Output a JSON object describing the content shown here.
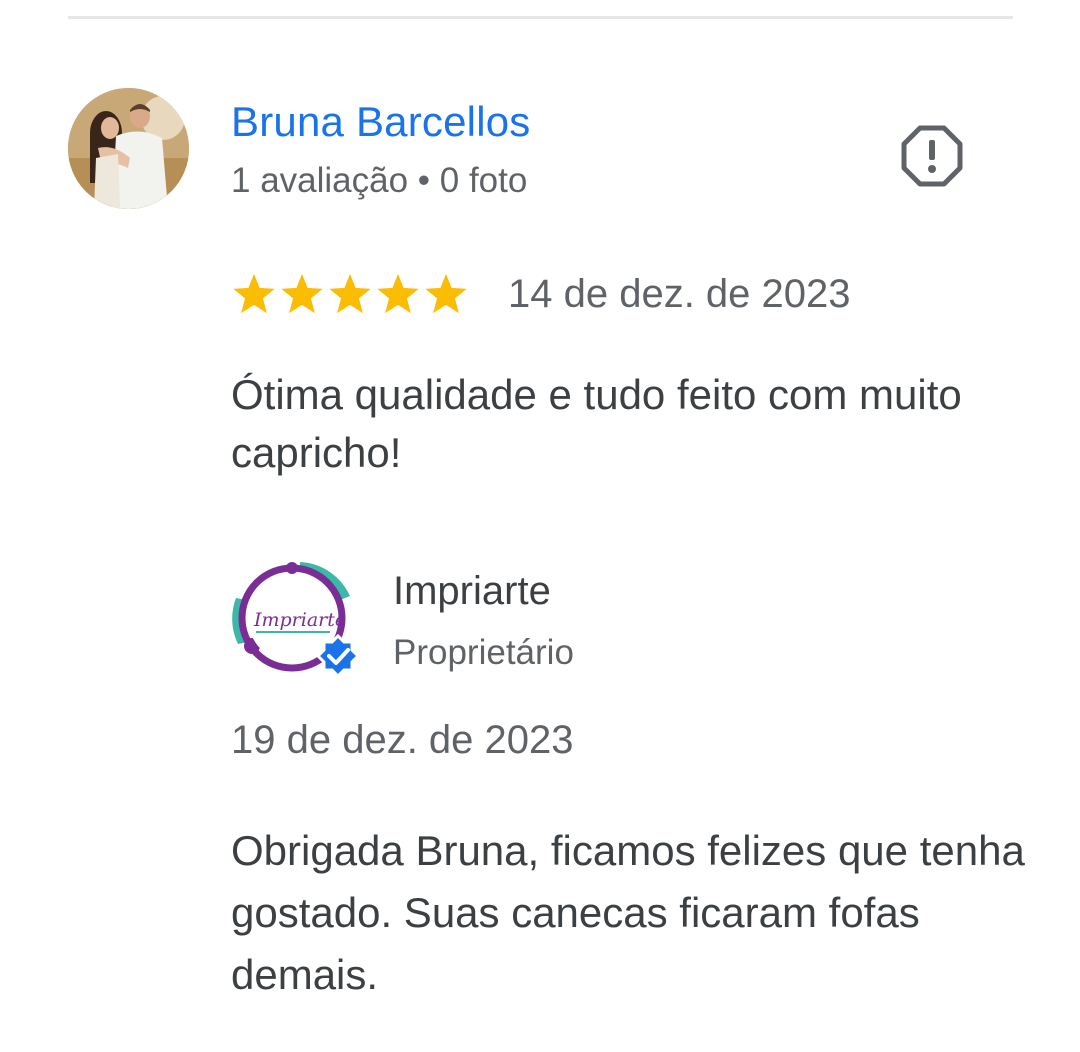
{
  "review": {
    "reviewer_name": "Bruna Barcellos",
    "reviewer_meta": "1 avaliação • 0 foto",
    "rating": 5,
    "max_rating": 5,
    "date": "14 de dez. de 2023",
    "text": "Ótima qualidade e tudo feito com muito capricho!",
    "avatar_icon": "reviewer-avatar-photo",
    "report_icon": "report-icon"
  },
  "owner_reply": {
    "name": "Impriarte",
    "role": "Proprietário",
    "date": "19 de dez. de 2023",
    "text": "Obrigada Bruna, ficamos felizes que tenha gostado. Suas canecas ficaram fofas demais.",
    "logo_text": "Impriarte",
    "verified_icon": "verified-badge-icon"
  },
  "colors": {
    "link_blue": "#1a73e8",
    "star_yellow": "#fbbc04",
    "text_dark": "#3c4043",
    "text_gray": "#5f6368",
    "verified_blue": "#1a73e8",
    "logo_purple": "#7b2d96",
    "logo_teal": "#3bb8a8"
  }
}
